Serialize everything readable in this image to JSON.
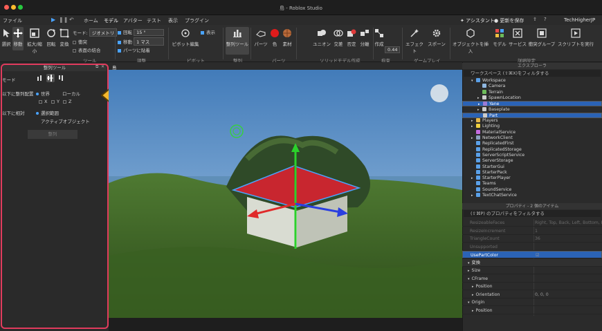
{
  "window": {
    "title": "島 - Roblox Studio"
  },
  "menu": {
    "file": "ファイル",
    "tabs": [
      "ホーム",
      "モデル",
      "アバター",
      "テスト",
      "表示",
      "プラグイン"
    ],
    "active_tab": "モデル",
    "assistant": "アシスタント",
    "updates": "更新を保存",
    "user": "TechHigherJP"
  },
  "ribbon": {
    "tools": [
      "選択",
      "移動",
      "拡大/縮小",
      "回転",
      "変換"
    ],
    "mode_label": "モード:",
    "mode_value": "ジオメトリ",
    "collisions": "衝突",
    "join_surfaces": "表面の結合",
    "rotate_label": "回転",
    "rotate_value": "15 °",
    "move_label": "移動",
    "move_value": "1 マス",
    "snap_parts": "パーツに貼着",
    "group_label": "ツール",
    "snap_group": "調整",
    "pivot_edit": "ピボット編集",
    "show": "表示",
    "pivot_group": "ピボット",
    "align_tool": "整列ツール",
    "align_group": "整列",
    "part_buttons": [
      "パーツ",
      "色",
      "素材"
    ],
    "part_group": "パーツ",
    "solid_buttons": [
      "ユニオン",
      "交差",
      "否定",
      "分離"
    ],
    "solid_group": "ソリッドモデル作成",
    "constraint_create": "作成",
    "constraint_value": "0.44",
    "constraint_group": "拘束",
    "effects": "エフェクト",
    "spawn": "スポーン",
    "gameplay_group": "ゲームプレイ",
    "advanced_buttons": [
      "オブジェクトを挿入",
      "モデル",
      "サービス",
      "衝突グループ",
      "スクリプトを実行"
    ],
    "advanced_group": "詳細設定"
  },
  "align_panel": {
    "title": "整列ツール",
    "mode_label": "モード",
    "align_in_label": "以下に整列配置",
    "world": "世界",
    "local": "ローカル",
    "axes": [
      "X",
      "Y",
      "Z"
    ],
    "relative_label": "以下に相対",
    "selection_bounds": "選択範囲",
    "active_object": "アクティブオブジェクト",
    "align_button": "整列"
  },
  "viewport": {
    "tab": "島"
  },
  "explorer": {
    "header": "エクスプローラ",
    "filter": "ワークスペース (⇧⌘X)をフィルタする",
    "items": [
      {
        "label": "Workspace",
        "indent": 1,
        "color": "#5aa0e8",
        "arrow": "▾",
        "selected": false
      },
      {
        "label": "Camera",
        "indent": 2,
        "color": "#8fb7e0",
        "arrow": "",
        "selected": false
      },
      {
        "label": "Terrain",
        "indent": 2,
        "color": "#6dbb5a",
        "arrow": "",
        "selected": false
      },
      {
        "label": "SpawnLocation",
        "indent": 2,
        "color": "#cccccc",
        "arrow": "▸",
        "selected": false
      },
      {
        "label": "Yane",
        "indent": 2,
        "color": "#9a7cd6",
        "arrow": "▸",
        "selected": true
      },
      {
        "label": "Baseplate",
        "indent": 2,
        "color": "#cccccc",
        "arrow": "▸",
        "selected": false
      },
      {
        "label": "Part",
        "indent": 2,
        "color": "#cccccc",
        "arrow": "",
        "selected": true
      },
      {
        "label": "Players",
        "indent": 1,
        "color": "#e6b84a",
        "arrow": "▸",
        "selected": false
      },
      {
        "label": "Lighting",
        "indent": 1,
        "color": "#f0d040",
        "arrow": "▸",
        "selected": false
      },
      {
        "label": "MaterialService",
        "indent": 1,
        "color": "#c46be0",
        "arrow": "",
        "selected": false
      },
      {
        "label": "NetworkClient",
        "indent": 1,
        "color": "#8aa0c0",
        "arrow": "▸",
        "selected": false
      },
      {
        "label": "ReplicatedFirst",
        "indent": 1,
        "color": "#5aa0e8",
        "arrow": "",
        "selected": false
      },
      {
        "label": "ReplicatedStorage",
        "indent": 1,
        "color": "#5aa0e8",
        "arrow": "",
        "selected": false
      },
      {
        "label": "ServerScriptService",
        "indent": 1,
        "color": "#5aa0e8",
        "arrow": "",
        "selected": false
      },
      {
        "label": "ServerStorage",
        "indent": 1,
        "color": "#5aa0e8",
        "arrow": "",
        "selected": false
      },
      {
        "label": "StarterGui",
        "indent": 1,
        "color": "#5aa0e8",
        "arrow": "",
        "selected": false
      },
      {
        "label": "StarterPack",
        "indent": 1,
        "color": "#5aa0e8",
        "arrow": "",
        "selected": false
      },
      {
        "label": "StarterPlayer",
        "indent": 1,
        "color": "#5aa0e8",
        "arrow": "▸",
        "selected": false
      },
      {
        "label": "Teams",
        "indent": 1,
        "color": "#5aa0e8",
        "arrow": "",
        "selected": false
      },
      {
        "label": "SoundService",
        "indent": 1,
        "color": "#5aa0e8",
        "arrow": "",
        "selected": false
      },
      {
        "label": "TextChatService",
        "indent": 1,
        "color": "#5aa0e8",
        "arrow": "▸",
        "selected": false
      }
    ]
  },
  "properties": {
    "header": "プロパティ - 2 個のアイテム",
    "filter": "(⇧⌘P) のプロパティをフィルタする",
    "rows": [
      {
        "name": "ResizeableFaces",
        "value": "Right, Top, Back, Left, Bottom, Fr...",
        "kind": "dim"
      },
      {
        "name": "ResizeIncrement",
        "value": "1",
        "kind": "dim"
      },
      {
        "name": "TriangleCount",
        "value": "36",
        "kind": "dim"
      },
      {
        "name": "Unsupported",
        "value": "",
        "kind": "dim"
      },
      {
        "name": "UsePartColor",
        "value": "☑",
        "kind": "sel"
      },
      {
        "name": "変換",
        "value": "",
        "kind": "cat"
      },
      {
        "name": "Size",
        "value": "",
        "kind": "row"
      },
      {
        "name": "CFrame",
        "value": "",
        "kind": "row"
      },
      {
        "name": "Position",
        "value": "",
        "kind": "sub"
      },
      {
        "name": "Orientation",
        "value": "0, 0, 0",
        "kind": "sub"
      },
      {
        "name": "Origin",
        "value": "",
        "kind": "row"
      },
      {
        "name": "Position",
        "value": "",
        "kind": "sub"
      }
    ]
  },
  "colors": {
    "accent": "#4aa3ff",
    "selection": "#2b63b6",
    "highlight_frame": "#e23b5d",
    "arrow": "#f5b82e",
    "roof": "#c8262f"
  }
}
